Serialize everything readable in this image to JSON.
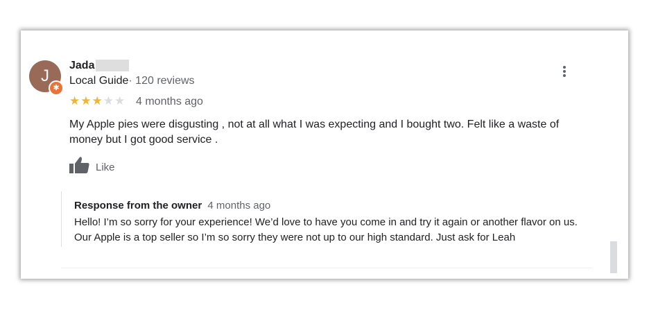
{
  "review": {
    "reviewer": {
      "initial": "J",
      "name": "Jada",
      "badge": "Local Guide",
      "separator": "·",
      "review_count": "120 reviews"
    },
    "rating": 3,
    "max_rating": 5,
    "date": "4 months ago",
    "text": "My Apple pies were disgusting , not at all what I was expecting and I bought two. Felt like a waste of money but I got good service .",
    "like_label": "Like"
  },
  "owner_response": {
    "title": "Response from the owner",
    "date": "4 months ago",
    "text": "Hello! I’m so sorry for your experience! We’d love to have you come in and try it again or another flavor on us. Our Apple is a top seller so I’m so sorry they were not up to our high standard. Just ask for Leah"
  },
  "colors": {
    "star_filled": "#f3b531",
    "star_empty": "#dadce0",
    "avatar": "#9a6a58",
    "guide_badge": "#e8743b"
  },
  "icons": [
    "more-vert-icon",
    "thumbs-up-icon",
    "local-guide-badge-icon"
  ]
}
